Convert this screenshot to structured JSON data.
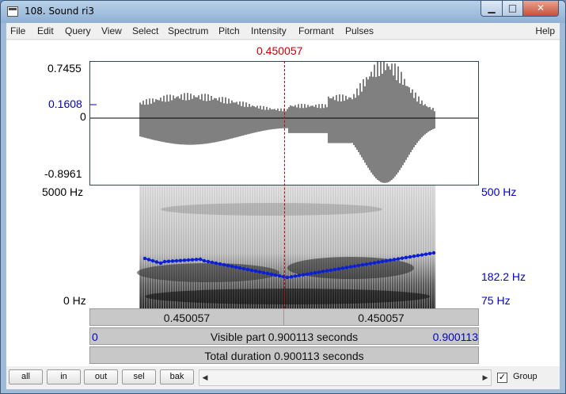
{
  "window": {
    "title": "108. Sound ri3",
    "minimize": "▁",
    "maximize": "□",
    "close": "✕"
  },
  "menu": [
    "File",
    "Edit",
    "Query",
    "View",
    "Select",
    "Spectrum",
    "Pitch",
    "Intensity",
    "Formant",
    "Pulses"
  ],
  "menu_help": "Help",
  "cursor": {
    "time_label": "0.450057"
  },
  "waveform": {
    "max": "0.7455",
    "cursor_value": "0.1608",
    "zero": "0",
    "min": "-0.8961"
  },
  "spectrogram": {
    "top_freq": "5000 Hz",
    "bottom_freq": "0 Hz"
  },
  "pitch": {
    "top": "500 Hz",
    "cursor": "182.2 Hz",
    "bottom": "75 Hz"
  },
  "bars": {
    "left_part": "0.450057",
    "right_part": "0.450057",
    "visible_start": "0",
    "visible": "Visible part 0.900113 seconds",
    "visible_end": "0.900113",
    "total": "Total duration 0.900113 seconds"
  },
  "buttons": [
    "all",
    "in",
    "out",
    "sel",
    "bak"
  ],
  "scroll": {
    "left": "◀",
    "right": "▶"
  },
  "group": {
    "checked": "✓",
    "label": "Group"
  },
  "colors": {
    "pitch": "#0a1fd6",
    "cursor": "#cc0000"
  }
}
